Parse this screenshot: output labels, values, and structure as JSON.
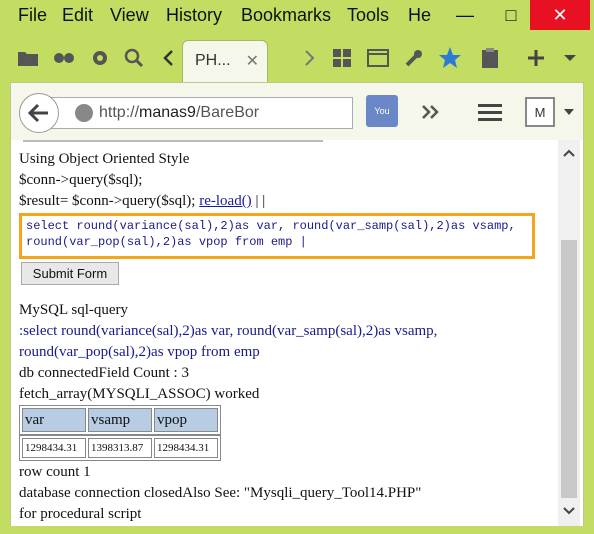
{
  "menubar": {
    "items": [
      "File",
      "Edit",
      "View",
      "History",
      "Bookmarks",
      "Tools",
      "He"
    ]
  },
  "window_controls": {
    "minimize": "—",
    "maximize": "□",
    "close": "✕"
  },
  "tab": {
    "label": "PH...",
    "close": "✕"
  },
  "url": {
    "prefix": "http://",
    "host": "manas9",
    "path": "/BareBor"
  },
  "page": {
    "line1": "Using Object Oriented Style",
    "line2": "$conn->query($sql);",
    "line3_text": "$result= $conn->query($sql); ",
    "line3_link": "re-load()",
    "line3_tail": " | |",
    "textarea_value": "select round(variance(sal),2)as var, round(var_samp(sal),2)as vsamp, round(var_pop(sal),2)as vpop from emp |",
    "submit_label": "Submit Form",
    "mysql_heading": "MySQL sql-query",
    "query_line1": ":select round(variance(sal),2)as var, round(var_samp(sal),2)as vsamp,",
    "query_line2": "round(var_pop(sal),2)as vpop from emp",
    "field_count": "db connectedField Count : 3",
    "fetch_status": "fetch_array(MYSQLI_ASSOC) worked",
    "table": {
      "headers": [
        "var",
        "vsamp",
        "vpop"
      ],
      "rows": [
        [
          "1298434.31",
          "1398313.87",
          "1298434.31"
        ]
      ]
    },
    "row_count": "row count 1",
    "closed_msg": "database connection closedAlso See: \"Mysqli_query_Tool14.PHP\"",
    "procedural": "for procedural script"
  },
  "colors": {
    "chrome": "#c3dd63",
    "textarea_border": "#f5a41c",
    "table_header": "#b8cce4",
    "query_text": "#1a1a8a"
  }
}
